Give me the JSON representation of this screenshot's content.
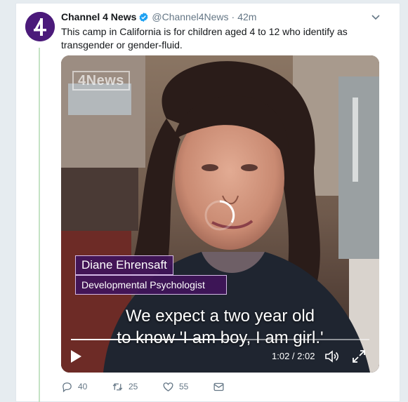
{
  "tweet": {
    "display_name": "Channel 4 News",
    "handle": "@Channel4News",
    "separator": "·",
    "time": "42m",
    "text": "This camp in California is for children aged 4 to 12 who identify as transgender or gender-fluid.",
    "verified_icon": "verified-badge-icon",
    "avatar_icon": "channel-4-logo"
  },
  "video": {
    "watermark": "4News",
    "lower_third": {
      "name": "Diane Ehrensaft",
      "title": "Developmental Psychologist"
    },
    "subtitles": [
      "We expect a two year old",
      "to know 'I am boy, I am girl.'"
    ],
    "timecode": "1:02 / 2:02",
    "progress": 0.508,
    "icons": {
      "play": "play-icon",
      "volume": "volume-icon",
      "fullscreen": "fullscreen-icon",
      "loading": "loading-spinner-icon"
    }
  },
  "actions": {
    "reply_count": "40",
    "retweet_count": "25",
    "like_count": "55"
  },
  "colors": {
    "brand_purple": "#4b1a7a",
    "verified_blue": "#1da1f2",
    "muted_text": "#657786",
    "thread_line": "#c4e3c4"
  }
}
